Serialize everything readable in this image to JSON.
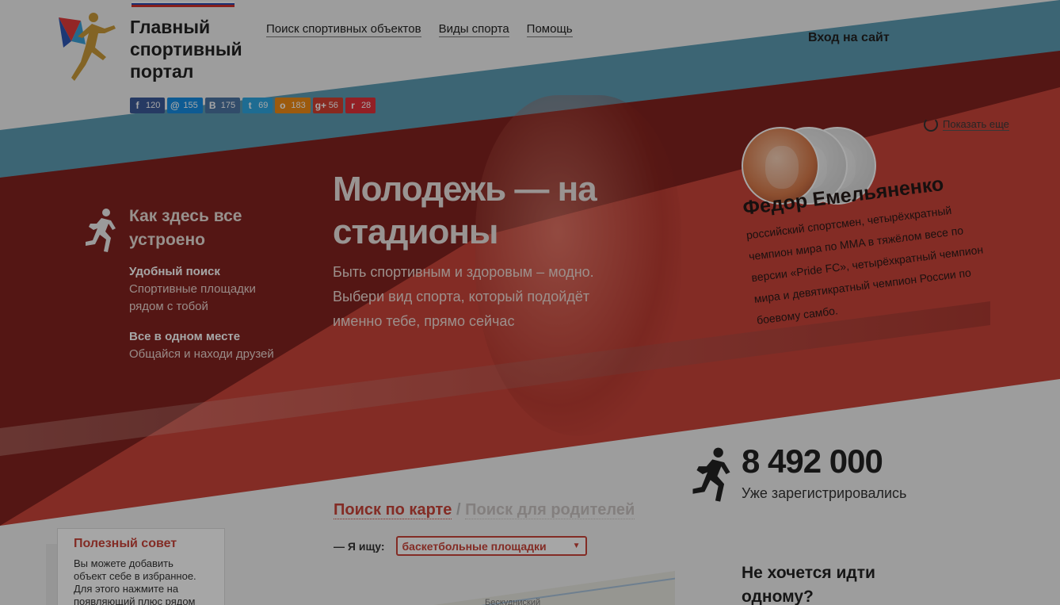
{
  "header": {
    "site_title": "Главный спортивный портал",
    "nav": [
      "Поиск спортивных объектов",
      "Виды спорта",
      "Помощь"
    ],
    "login": "Вход на сайт"
  },
  "social": [
    {
      "glyph": "f",
      "count": "120",
      "color": "#3b5998"
    },
    {
      "glyph": "@",
      "count": "155",
      "color": "#168de2"
    },
    {
      "glyph": "B",
      "count": "175",
      "color": "#4c75a3"
    },
    {
      "glyph": "t",
      "count": "69",
      "color": "#2fa7e0"
    },
    {
      "glyph": "o",
      "count": "183",
      "color": "#f08a14"
    },
    {
      "glyph": "g+",
      "count": "56",
      "color": "#d23f31"
    },
    {
      "glyph": "r",
      "count": "28",
      "color": "#e0303a"
    }
  ],
  "show_more": "Показать еще",
  "how": {
    "title": "Как здесь все устроено",
    "features": [
      {
        "title": "Удобный поиск",
        "text": "Спортивные площадки рядом с тобой"
      },
      {
        "title": "Все в одном месте",
        "text": "Общайся и находи друзей"
      }
    ]
  },
  "hero": {
    "title": "Молодежь — на стадионы",
    "subtitle": "Быть спортивным и здоровым – модно. Выбери вид спорта, который подойдёт именно тебе, прямо сейчас"
  },
  "athlete": {
    "name": "Федор Емельяненко",
    "bio": "российский спортсмен, четырёхкратный чемпион мира по MMA в тяжёлом весе по версии «Pride FC», четырёхкратный чемпион мира и девятикратный чемпион России по боевому самбо."
  },
  "stats": {
    "count": "8 492 000",
    "label": "Уже зарегистрировались"
  },
  "search": {
    "tab_active": "Поиск по карте",
    "tab_separator": "/",
    "tab_inactive": "Поиск для родителей",
    "seek_label": "— Я ищу:",
    "select_value": "баскетбольные площадки"
  },
  "map": {
    "label": "Бескудниский"
  },
  "tip": {
    "title": "Полезный совет",
    "text": "Вы можете добавить объект себе в избранное. Для этого нажмите на появляющий плюс рядом"
  },
  "promo": {
    "title": "Не хочется идти одному?"
  }
}
